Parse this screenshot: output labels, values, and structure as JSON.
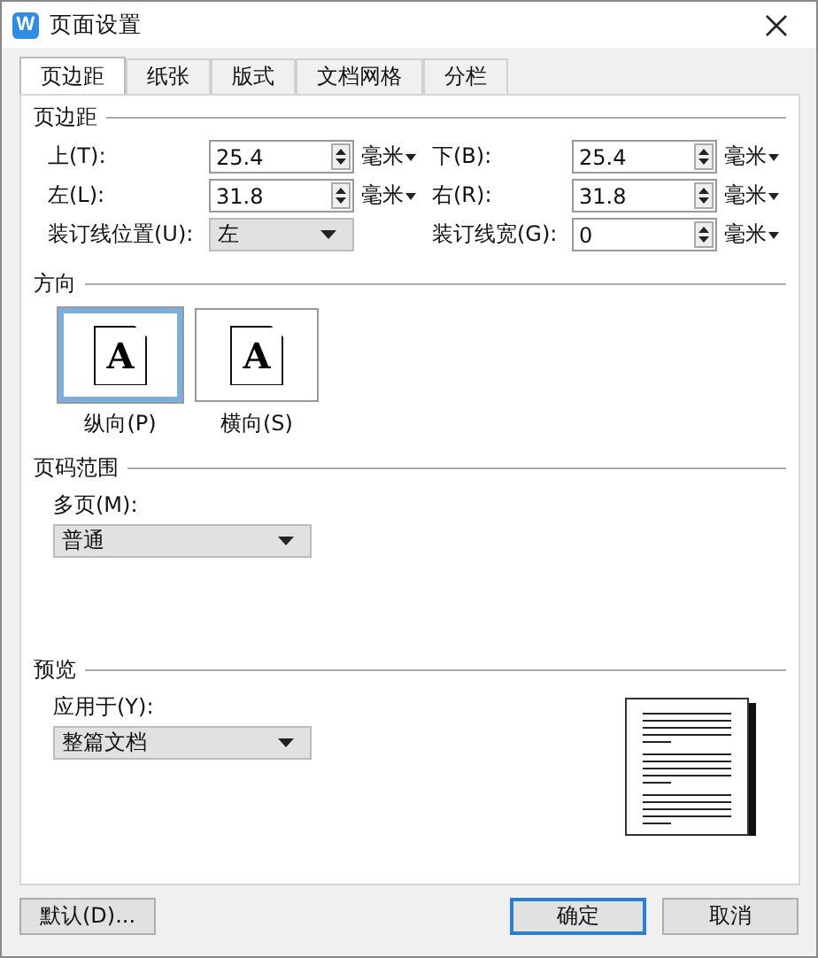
{
  "window": {
    "icon_letter": "W",
    "title": "页面设置"
  },
  "tabs": [
    {
      "label": "页边距",
      "selected": true
    },
    {
      "label": "纸张",
      "selected": false
    },
    {
      "label": "版式",
      "selected": false
    },
    {
      "label": "文档网格",
      "selected": false
    },
    {
      "label": "分栏",
      "selected": false
    }
  ],
  "margins": {
    "title": "页边距",
    "fields": [
      {
        "kind": "spin",
        "label": "上(T):",
        "value": "25.4",
        "unit": "毫米"
      },
      {
        "kind": "spin",
        "label": "下(B):",
        "value": "25.4",
        "unit": "毫米"
      },
      {
        "kind": "spin",
        "label": "左(L):",
        "value": "31.8",
        "unit": "毫米"
      },
      {
        "kind": "spin",
        "label": "右(R):",
        "value": "31.8",
        "unit": "毫米"
      },
      {
        "kind": "select",
        "label": "装订线位置(U):",
        "value": "左"
      },
      {
        "kind": "spin",
        "label": "装订线宽(G):",
        "value": "0",
        "unit": "毫米"
      }
    ]
  },
  "orientation": {
    "title": "方向",
    "options": [
      {
        "label": "纵向(P)",
        "glyph": "A",
        "selected": true
      },
      {
        "label": "横向(S)",
        "glyph": "A",
        "selected": false
      }
    ]
  },
  "page_range": {
    "title": "页码范围",
    "label": "多页(M):",
    "value": "普通"
  },
  "preview": {
    "title": "预览",
    "label": "应用于(Y):",
    "value": "整篇文档"
  },
  "buttons": [
    {
      "label": "默认(D)...",
      "kind": "left",
      "default": false
    },
    {
      "label": "确定",
      "kind": "right",
      "default": true
    },
    {
      "label": "取消",
      "kind": "right",
      "default": false
    }
  ]
}
